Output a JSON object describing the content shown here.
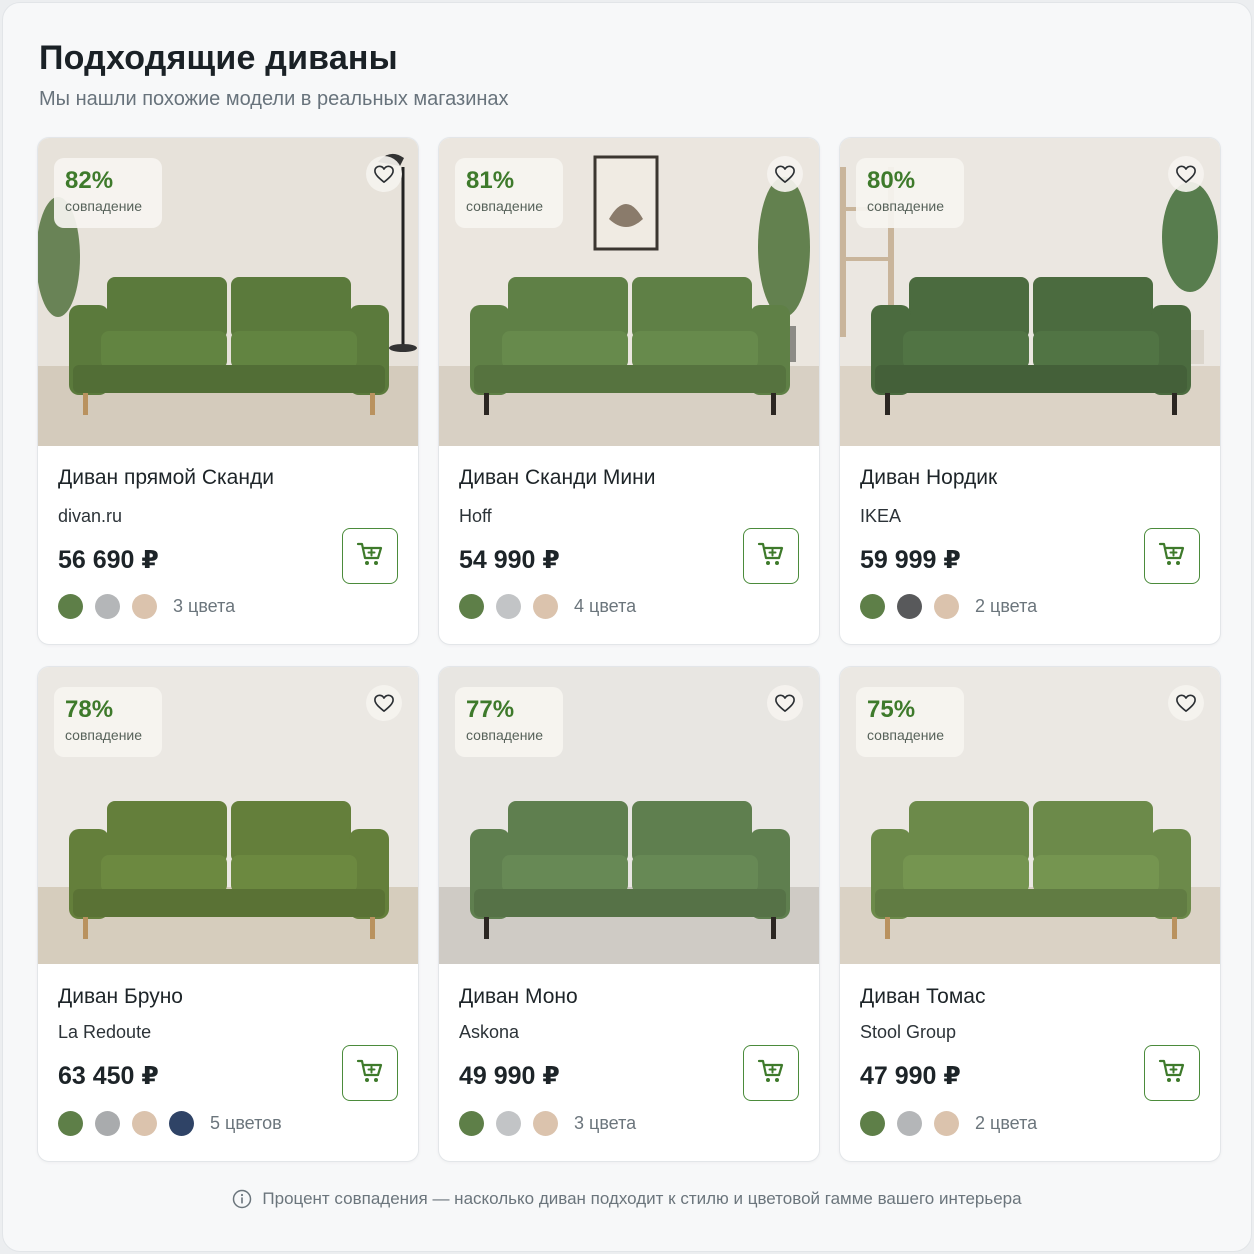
{
  "header": {
    "title": "Подходящие диваны",
    "subtitle": "Мы нашли похожие модели в реальных магазинах"
  },
  "match_label": "совпадение",
  "products": [
    {
      "match": "82%",
      "name": "Диван прямой Сканди",
      "store": "divan.ru",
      "price": "56 690 ₽",
      "colors": [
        "#5e7f48",
        "#b4b6b8",
        "#dbc3ad"
      ],
      "colors_label": "3 цвета",
      "sofa_color": "#5b7a3c",
      "wall_color": "#e7e2da",
      "floor_color": "#d4cbbc"
    },
    {
      "match": "81%",
      "name": "Диван Сканди Мини",
      "store": "Hoff",
      "price": "54 990 ₽",
      "colors": [
        "#5e7f48",
        "#c2c4c6",
        "#dbc3ad"
      ],
      "colors_label": "4 цвета",
      "sofa_color": "#5f8046",
      "wall_color": "#ebe6df",
      "floor_color": "#d8d0c4"
    },
    {
      "match": "80%",
      "name": "Диван Нордик",
      "store": "IKEA",
      "price": "59 999 ₽",
      "colors": [
        "#5e7f48",
        "#58595b",
        "#dbc3ad"
      ],
      "colors_label": "2 цвета",
      "sofa_color": "#4b6b3f",
      "wall_color": "#ebe7e1",
      "floor_color": "#dcd3c6"
    },
    {
      "match": "78%",
      "name": "Диван Бруно",
      "store": "La Redoute",
      "price": "63 450 ₽",
      "colors": [
        "#5e7f48",
        "#a9abad",
        "#dbc3ad",
        "#2f4366"
      ],
      "colors_label": "5 цветов",
      "sofa_color": "#647f3b",
      "wall_color": "#ebe8e3",
      "floor_color": "#d6cdbd"
    },
    {
      "match": "77%",
      "name": "Диван Моно",
      "store": "Askona",
      "price": "49 990 ₽",
      "colors": [
        "#5e7f48",
        "#c2c4c6",
        "#dbc3ad"
      ],
      "colors_label": "3 цвета",
      "sofa_color": "#5f7f4f",
      "wall_color": "#e8e6e2",
      "floor_color": "#cfcbc5"
    },
    {
      "match": "75%",
      "name": "Диван Томас",
      "store": "Stool Group",
      "price": "47 990 ₽",
      "colors": [
        "#5e7f48",
        "#b4b6b8",
        "#dbc3ad"
      ],
      "colors_label": "2 цвета",
      "sofa_color": "#6c8a4a",
      "wall_color": "#ebe8e3",
      "floor_color": "#dad2c5"
    }
  ],
  "footnote": "Процент совпадения — насколько диван подходит к стилю и цветовой гамме вашего интерьера",
  "icons": {
    "favorite": "heart-icon",
    "cart": "cart-icon",
    "info": "info-icon"
  }
}
